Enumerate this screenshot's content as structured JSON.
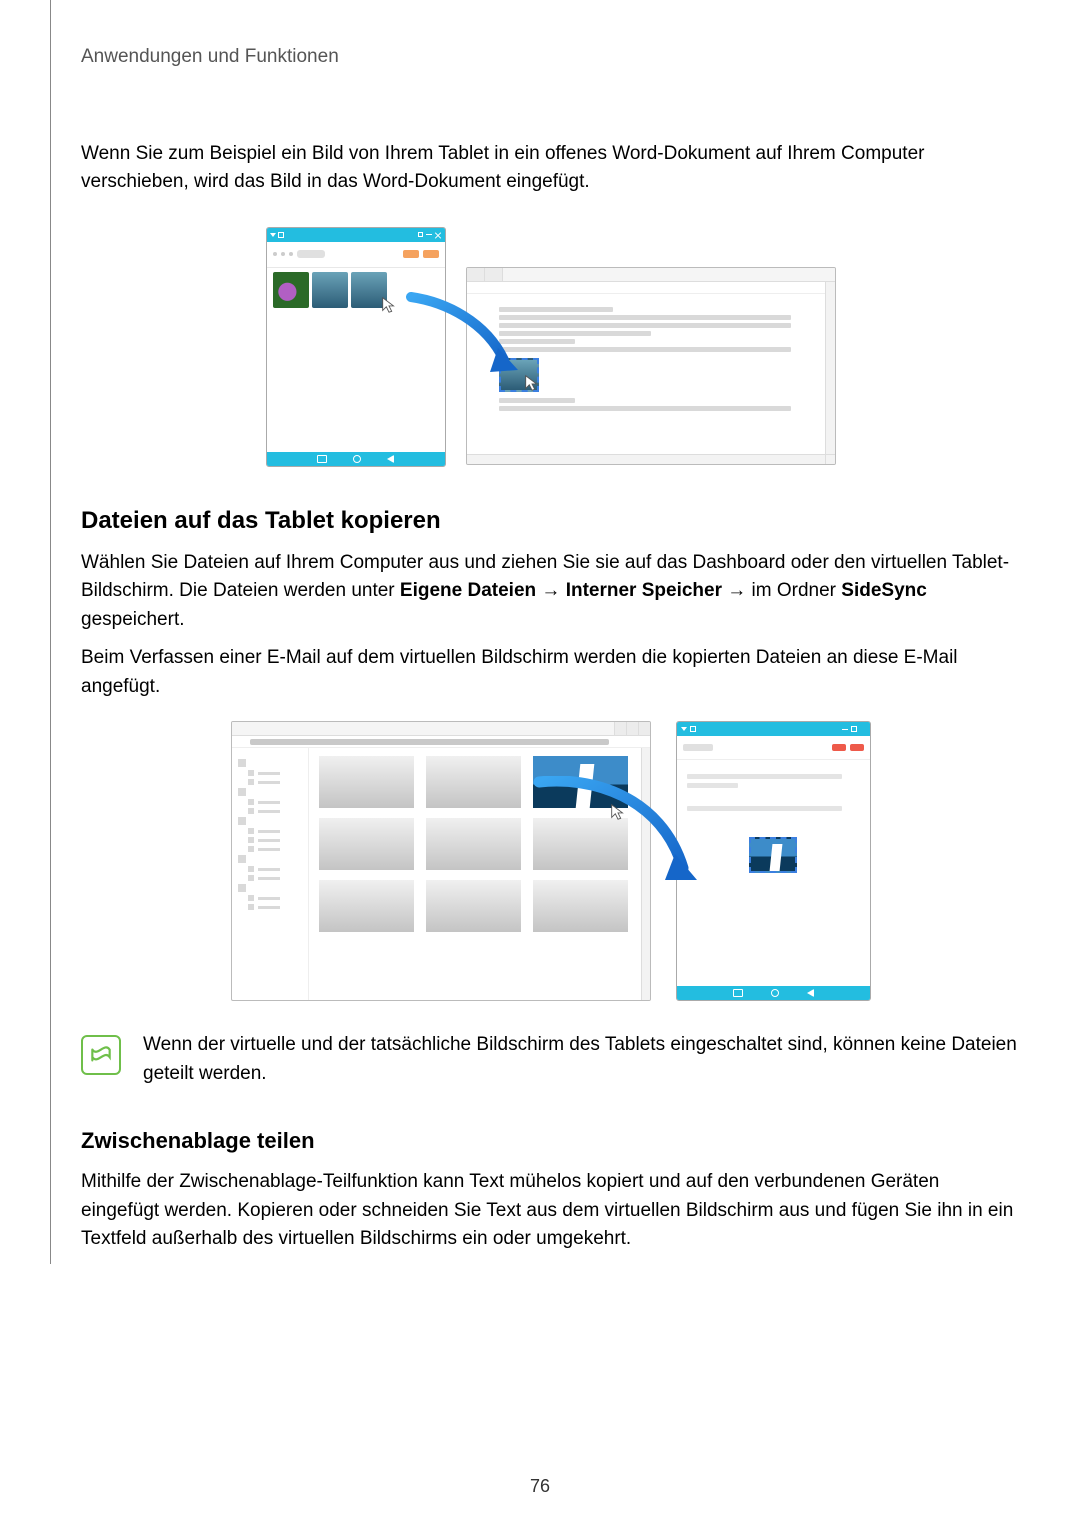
{
  "header": {
    "title": "Anwendungen und Funktionen"
  },
  "intro_paragraph": "Wenn Sie zum Beispiel ein Bild von Ihrem Tablet in ein offenes Word-Dokument auf Ihrem Computer verschieben, wird das Bild in das Word-Dokument eingefügt.",
  "section1": {
    "heading": "Dateien auf das Tablet kopieren",
    "p1_part1": "Wählen Sie Dateien auf Ihrem Computer aus und ziehen Sie sie auf das Dashboard oder den virtuellen Tablet-Bildschirm. Die Dateien werden unter ",
    "bold1": "Eigene Dateien",
    "arrow": " → ",
    "bold2": "Interner Speicher",
    "p1_part2": " im Ordner ",
    "bold3": "SideSync",
    "p1_part3": " gespeichert.",
    "p2": "Beim Verfassen einer E-Mail auf dem virtuellen Bildschirm werden die kopierten Dateien an diese E-Mail angefügt."
  },
  "note": {
    "text": "Wenn der virtuelle und der tatsächliche Bildschirm des Tablets eingeschaltet sind, können keine Dateien geteilt werden."
  },
  "section2": {
    "heading": "Zwischenablage teilen",
    "p1": "Mithilfe der Zwischenablage-Teilfunktion kann Text mühelos kopiert und auf den verbundenen Geräten eingefügt werden. Kopieren oder schneiden Sie Text aus dem virtuellen Bildschirm aus und fügen Sie ihn in ein Textfeld außerhalb des virtuellen Bildschirms ein oder umgekehrt."
  },
  "page_number": "76"
}
